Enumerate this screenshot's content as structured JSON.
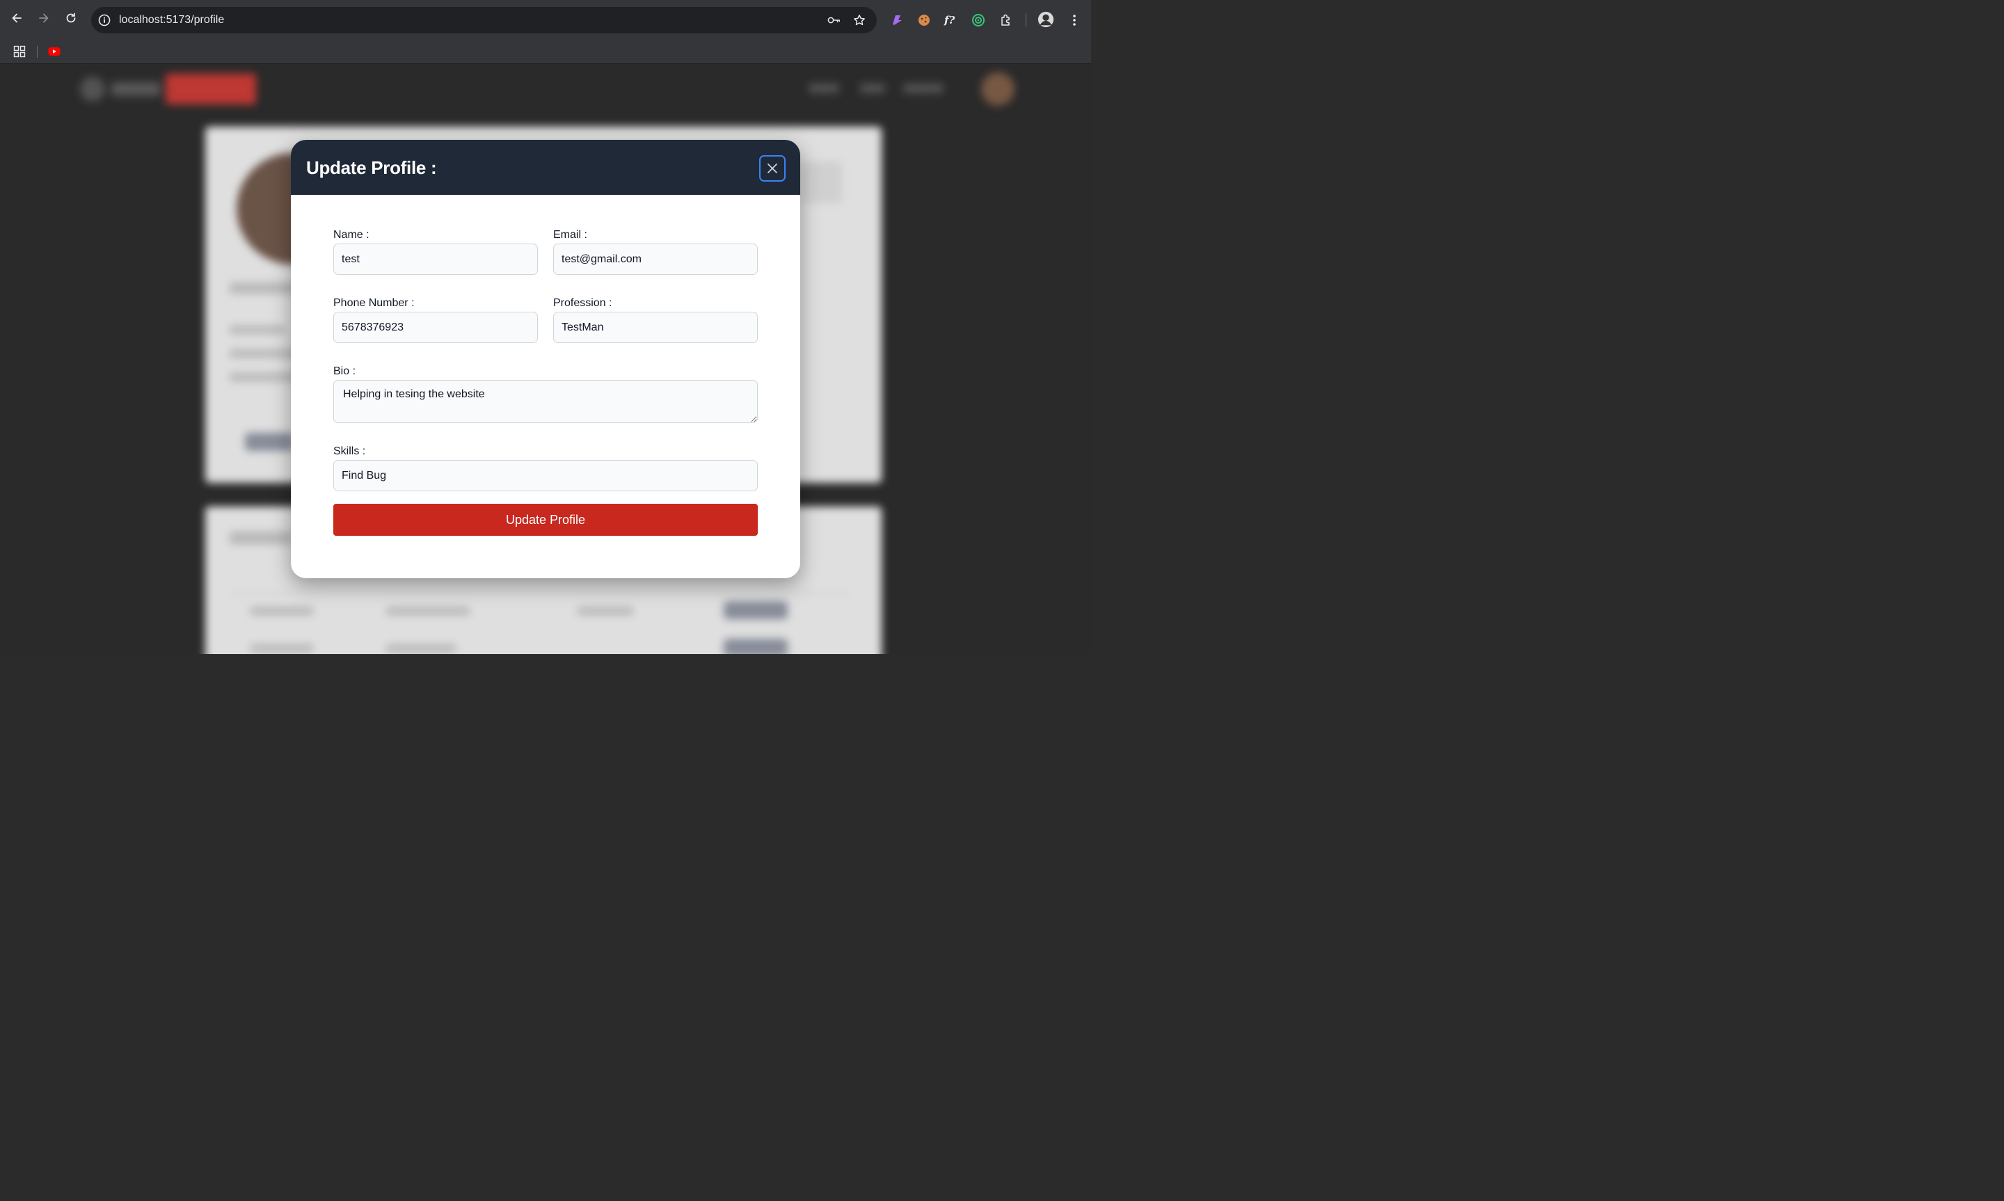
{
  "browser": {
    "url": "localhost:5173/profile"
  },
  "modal": {
    "title": "Update Profile :",
    "fields": {
      "name": {
        "label": "Name :",
        "value": "test"
      },
      "email": {
        "label": "Email :",
        "value": "test@gmail.com"
      },
      "phone": {
        "label": "Phone Number :",
        "value": "5678376923"
      },
      "profession": {
        "label": "Profession :",
        "value": "TestMan"
      },
      "bio": {
        "label": "Bio :",
        "value": "Helping in tesing the website"
      },
      "skills": {
        "label": "Skills :",
        "value": "Find Bug"
      }
    },
    "submit_label": "Update Profile"
  },
  "colors": {
    "header_bg": "#1f2937",
    "submit_bg": "#c8281e",
    "focus_ring": "#3b82f6"
  }
}
